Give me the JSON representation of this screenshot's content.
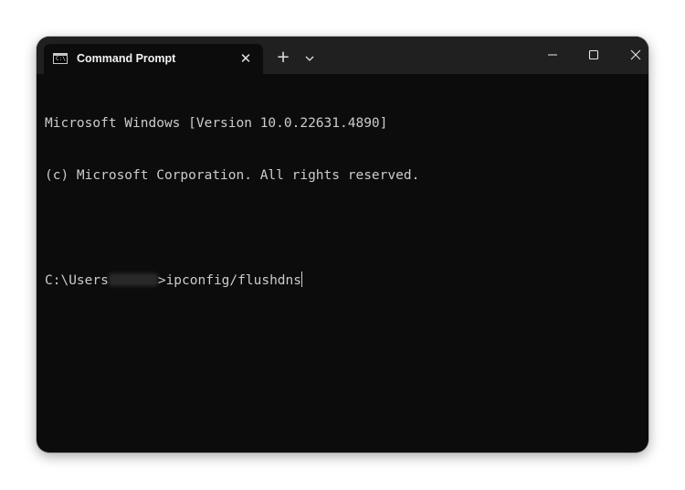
{
  "tab": {
    "title": "Command Prompt",
    "icon_text": "C:\\."
  },
  "buttons": {
    "new_tab": "+",
    "close_tab": "✕"
  },
  "console": {
    "line1": "Microsoft Windows [Version 10.0.22631.4890]",
    "line2": "(c) Microsoft Corporation. All rights reserved.",
    "prompt_prefix": "C:\\Users",
    "prompt_suffix": ">",
    "command": "ipconfig/flushdns"
  },
  "colors": {
    "background": "#0c0c0c",
    "titlebar": "#202020",
    "text": "#cccccc"
  },
  "icons": {
    "app": "command-prompt-icon",
    "close_tab": "close-icon",
    "new_tab": "plus-icon",
    "dropdown": "chevron-down-icon",
    "minimize": "minimize-icon",
    "maximize": "maximize-icon",
    "close_window": "close-icon"
  }
}
